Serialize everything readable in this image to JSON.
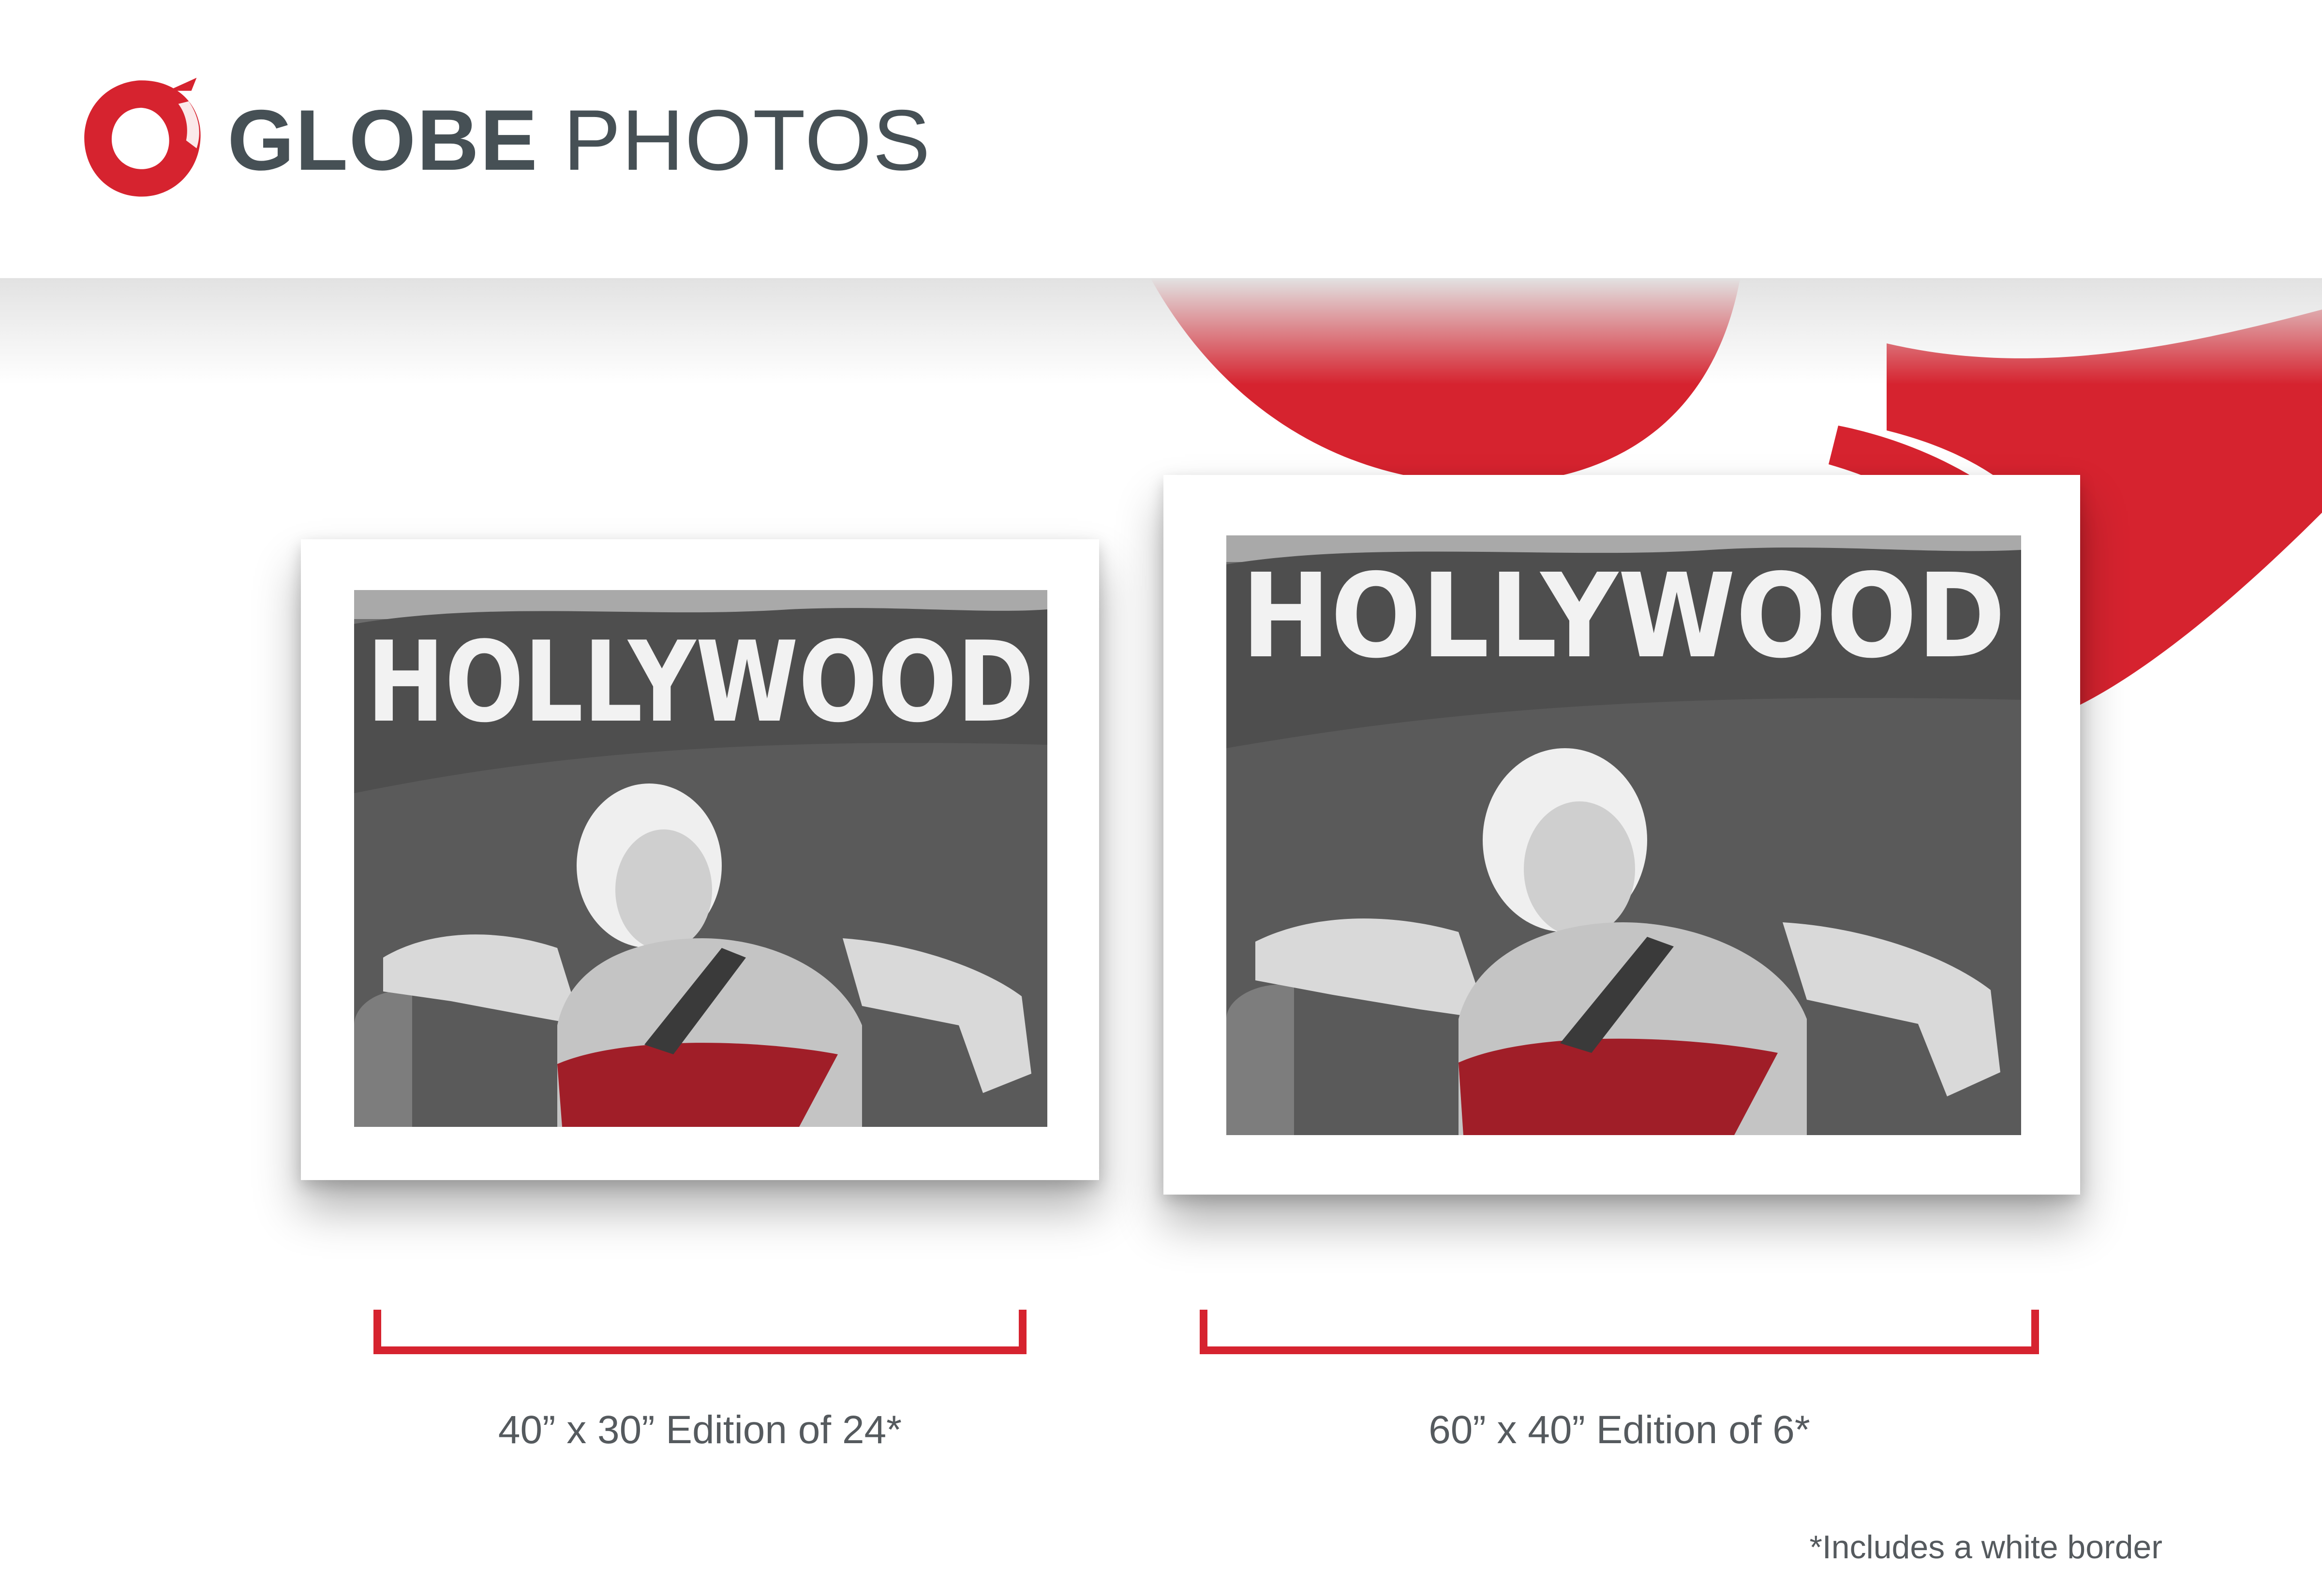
{
  "brand": {
    "name_bold": "GLOBE",
    "name_light": "PHOTOS",
    "logo_icon": "brush-ring-icon",
    "accent_color": "#d6232f",
    "text_color": "#465055"
  },
  "prints": [
    {
      "photo_sign_text": "HOLLYWOOD",
      "caption": "40” x 30” Edition of 24*"
    },
    {
      "photo_sign_text": "HOLLYWOOD",
      "caption": "60” x 40” Edition of 6*"
    }
  ],
  "footnote": "*Includes a white border"
}
